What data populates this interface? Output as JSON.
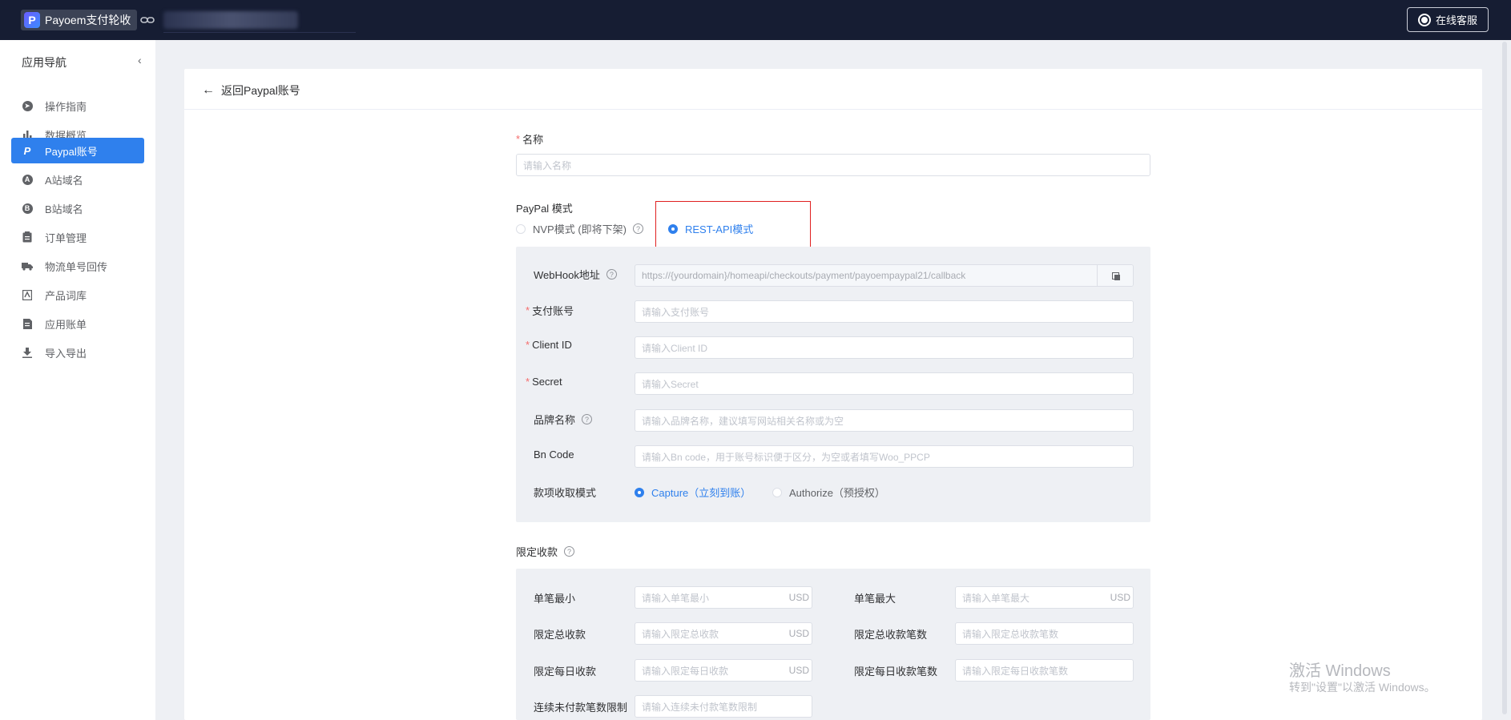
{
  "topbar": {
    "brand_logo": "P",
    "brand_name": "Payoem支付轮收",
    "service_button": "在线客服"
  },
  "sidebar": {
    "title": "应用导航",
    "collapse_icon": "chevron-left-icon",
    "items": [
      {
        "label": "操作指南",
        "icon": "compass-icon"
      },
      {
        "label": "数据概览",
        "icon": "bar-chart-icon"
      },
      {
        "label": "Paypal账号",
        "icon": "paypal-icon",
        "active": true
      },
      {
        "label": "A站域名",
        "icon": "a-circle-icon"
      },
      {
        "label": "B站域名",
        "icon": "b-circle-icon"
      },
      {
        "label": "订单管理",
        "icon": "clipboard-icon"
      },
      {
        "label": "物流单号回传",
        "icon": "truck-icon"
      },
      {
        "label": "产品词库",
        "icon": "book-icon"
      },
      {
        "label": "应用账单",
        "icon": "receipt-icon"
      },
      {
        "label": "导入导出",
        "icon": "download-icon"
      }
    ]
  },
  "header": {
    "back_label": "返回Paypal账号"
  },
  "form": {
    "name_label": "名称",
    "name_placeholder": "请输入名称",
    "paypal_mode_label": "PayPal 模式",
    "mode_options": {
      "nvp": "NVP模式 (即将下架)",
      "rest": "REST-API模式"
    },
    "selected_mode": "REST-API模式",
    "webhook_label": "WebHook地址",
    "webhook_value": "https://{yourdomain}/homeapi/checkouts/payment/payoempaypal21/callback",
    "account_label": "支付账号",
    "account_placeholder": "请输入支付账号",
    "client_id_label": "Client ID",
    "client_id_placeholder": "请输入Client ID",
    "secret_label": "Secret",
    "secret_placeholder": "请输入Secret",
    "brand_label": "品牌名称",
    "brand_placeholder": "请输入品牌名称，建议填写网站相关名称或为空",
    "bn_label": "Bn Code",
    "bn_placeholder": "请输入Bn code，用于账号标识便于区分，为空或者填写Woo_PPCP",
    "capture_mode_label": "款项收取模式",
    "capture_options": {
      "capture": "Capture（立刻到账）",
      "authorize": "Authorize（预授权）"
    },
    "selected_capture": "Capture（立刻到账）"
  },
  "limits": {
    "title": "限定收款",
    "currency": "USD",
    "single_min_label": "单笔最小",
    "single_min_placeholder": "请输入单笔最小",
    "single_max_label": "单笔最大",
    "single_max_placeholder": "请输入单笔最大",
    "total_label": "限定总收款",
    "total_placeholder": "请输入限定总收款",
    "total_count_label": "限定总收款笔数",
    "total_count_placeholder": "请输入限定总收款笔数",
    "daily_label": "限定每日收款",
    "daily_placeholder": "请输入限定每日收款",
    "daily_count_label": "限定每日收款笔数",
    "daily_count_placeholder": "请输入限定每日收款笔数",
    "unpaid_label": "连续未付款笔数限制",
    "unpaid_placeholder": "请输入连续未付款笔数限制"
  },
  "watermark": {
    "line1": "激活 Windows",
    "line2": "转到\"设置\"以激活 Windows。"
  }
}
